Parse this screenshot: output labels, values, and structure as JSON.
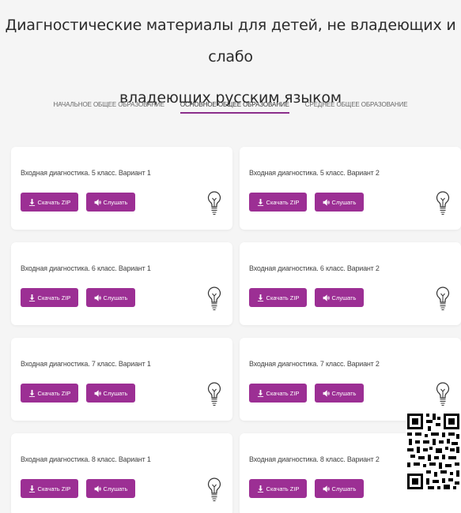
{
  "page": {
    "title_line1": "Диагностические материалы для детей, не владеющих и слабо",
    "title_line2": "владеющих русским языком"
  },
  "tabs": [
    {
      "label": "НАЧАЛЬНОЕ ОБЩЕЕ ОБРАЗОВАНИЕ",
      "active": false
    },
    {
      "label": "ОСНОВНОЕ ОБЩЕЕ ОБРАЗОВАНИЕ",
      "active": true
    },
    {
      "label": "СРЕДНЕЕ ОБЩЕЕ ОБРАЗОВАНИЕ",
      "active": false
    }
  ],
  "buttons": {
    "zip_label": "Скачать ZIP",
    "listen_label": "Слушать"
  },
  "cards": [
    {
      "title": "Входная диагностика. 5 класс. Вариант 1"
    },
    {
      "title": "Входная диагностика. 5 класс. Вариант 2"
    },
    {
      "title": "Входная диагностика. 6 класс. Вариант 1"
    },
    {
      "title": "Входная диагностика. 6 класс. Вариант 2"
    },
    {
      "title": "Входная диагностика. 7 класс. Вариант 1"
    },
    {
      "title": "Входная диагностика. 7 класс. Вариант 2"
    },
    {
      "title": "Входная диагностика. 8 класс. Вариант 1"
    },
    {
      "title": "Входная диагностика. 8 класс. Вариант 2"
    }
  ],
  "icons": {
    "download": "download-icon",
    "listen": "speaker-icon",
    "card": "lightbulb-icon",
    "qr": "qr-code"
  },
  "colors": {
    "accent": "#9c2f94",
    "background": "#f5f5f5",
    "card": "#ffffff"
  }
}
